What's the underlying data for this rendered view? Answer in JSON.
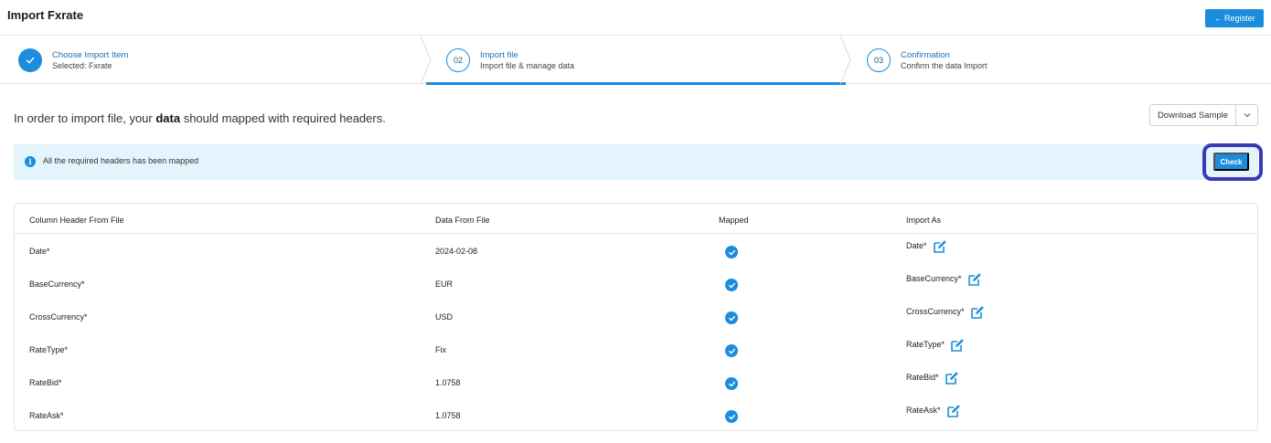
{
  "header": {
    "title": "Import Fxrate",
    "register_label": "← Register"
  },
  "stepper": {
    "steps": [
      {
        "number": "",
        "title": "Choose Import Item",
        "subtitle_prefix": "Selected: ",
        "subtitle_value": "Fxrate",
        "state": "done"
      },
      {
        "number": "02",
        "title": "Import file",
        "subtitle": "Import file & manage data",
        "state": "active"
      },
      {
        "number": "03",
        "title": "Confirmation",
        "subtitle": "Confirm the data Import",
        "state": "pending"
      }
    ]
  },
  "intro": {
    "before": "In order to import file, your ",
    "bold": "data",
    "after": " should mapped with required headers."
  },
  "download": {
    "label": "Download Sample"
  },
  "alert": {
    "icon": "info-icon",
    "text": "All the required headers has been mapped",
    "check_label": "Check"
  },
  "table": {
    "headers": [
      "Column Header From File",
      "Data From File",
      "Mapped",
      "Import As"
    ],
    "rows": [
      {
        "column": "Date*",
        "data": "2024-02-08",
        "mapped": true,
        "import_as": "Date*"
      },
      {
        "column": "BaseCurrency*",
        "data": "EUR",
        "mapped": true,
        "import_as": "BaseCurrency*"
      },
      {
        "column": "CrossCurrency*",
        "data": "USD",
        "mapped": true,
        "import_as": "CrossCurrency*"
      },
      {
        "column": "RateType*",
        "data": "Fix",
        "mapped": true,
        "import_as": "RateType*"
      },
      {
        "column": "RateBid*",
        "data": "1.0758",
        "mapped": true,
        "import_as": "RateBid*"
      },
      {
        "column": "RateAsk*",
        "data": "1.0758",
        "mapped": true,
        "import_as": "RateAsk*"
      }
    ]
  },
  "colors": {
    "primary": "#1b8ddc",
    "alert_bg": "#e3f4fd",
    "highlight": "#3b39b8"
  }
}
